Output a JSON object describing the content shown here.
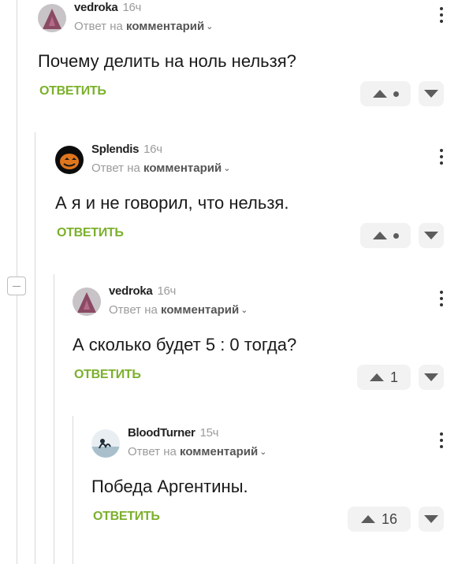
{
  "comments": [
    {
      "author": "vedroka",
      "time": "16ч",
      "reply_prefix": "Ответ на",
      "reply_target": "комментарий",
      "text": "Почему делить на ноль нельзя?",
      "reply_label": "ОТВЕТИТЬ",
      "score": "",
      "avatar_icon": "witch-hat-avatar"
    },
    {
      "author": "Splendis",
      "time": "16ч",
      "reply_prefix": "Ответ на",
      "reply_target": "комментарий",
      "text": "А я и не говорил, что нельзя.",
      "reply_label": "ОТВЕТИТЬ",
      "score": "",
      "avatar_icon": "pumpkin-avatar"
    },
    {
      "author": "vedroka",
      "time": "16ч",
      "reply_prefix": "Ответ на",
      "reply_target": "комментарий",
      "text": "А сколько будет 5 : 0 тогда?",
      "reply_label": "ОТВЕТИТЬ",
      "score": "1",
      "avatar_icon": "witch-hat-avatar"
    },
    {
      "author": "BloodTurner",
      "time": "15ч",
      "reply_prefix": "Ответ на",
      "reply_target": "комментарий",
      "text": "Победа Аргентины.",
      "reply_label": "ОТВЕТИТЬ",
      "score": "16",
      "avatar_icon": "landscape-avatar"
    }
  ],
  "colors": {
    "accent_green": "#7bb02b",
    "muted": "#9b9b9b",
    "thread_line": "#d9d9d9"
  }
}
